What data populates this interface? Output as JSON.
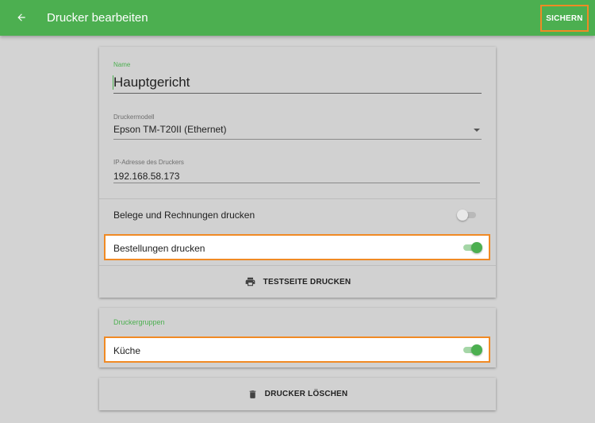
{
  "appbar": {
    "back_icon": "arrow-back-icon",
    "title": "Drucker bearbeiten",
    "save_label": "SICHERN",
    "color": "#4caf50"
  },
  "printer": {
    "name_label": "Name",
    "name_value": "Hauptgericht",
    "model_label": "Druckermodell",
    "model_value": "Epson TM-T20II (Ethernet)",
    "ip_label": "IP-Adresse des Druckers",
    "ip_value": "192.168.58.173",
    "receipts_label": "Belege und Rechnungen drucken",
    "receipts_enabled": false,
    "orders_label": "Bestellungen drucken",
    "orders_enabled": true,
    "test_icon": "printer-icon",
    "test_label": "TESTSEITE DRUCKEN"
  },
  "groups": {
    "title": "Druckergruppen",
    "items": [
      {
        "label": "Küche",
        "enabled": true
      }
    ]
  },
  "delete": {
    "icon": "trash-icon",
    "label": "DRUCKER LÖSCHEN"
  },
  "colors": {
    "accent": "#4caf50",
    "highlight_border": "#f08a24",
    "background": "#d3d3d3"
  }
}
